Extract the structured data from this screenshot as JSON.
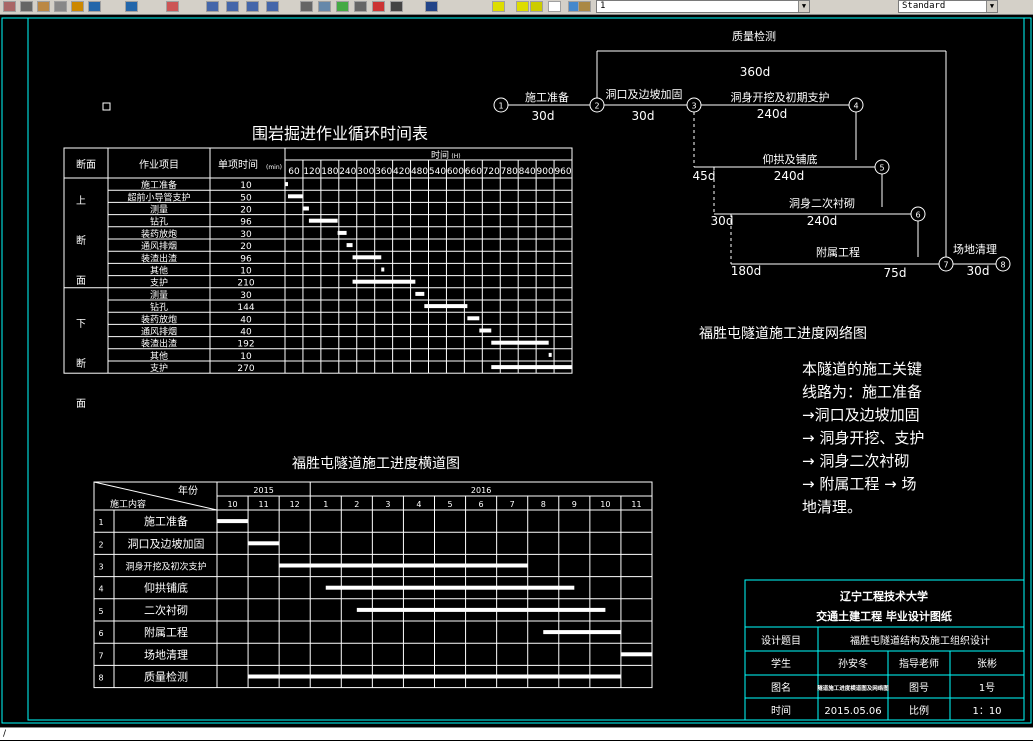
{
  "toolbar": {
    "layer_value": "1",
    "style_value": "Standard",
    "icons": [
      "cut-icon",
      "copy-icon",
      "paste-icon",
      "match-properties-icon",
      "brush-icon",
      "undo-icon",
      "redo-icon",
      "pan-icon",
      "zoom-realtime-icon",
      "zoom-window-icon",
      "zoom-previous-icon",
      "properties-icon",
      "design-center-icon",
      "tool-palettes-icon",
      "sheet-set-icon",
      "markup-icon",
      "calculator-icon",
      "help-icon",
      "layer-manager-icon",
      "lightbulb-icon",
      "sun-icon",
      "lock-icon",
      "color-square-icon",
      "layer-state-icon",
      "text-style-icon"
    ]
  },
  "cycle_table": {
    "title": "围岩掘进作业循环时间表",
    "headers": {
      "section": "断面",
      "task": "作业项目",
      "unit_time": "单项时间",
      "unit_time_unit": "(min)",
      "time": "时间",
      "time_unit": "(H)"
    },
    "ticks": [
      "60",
      "120",
      "180",
      "240",
      "300",
      "360",
      "420",
      "480",
      "540",
      "600",
      "660",
      "720",
      "780",
      "840",
      "900",
      "960"
    ],
    "upper_section": [
      "上",
      "断",
      "面"
    ],
    "lower_section": [
      "下",
      "断",
      "面"
    ],
    "rows": [
      {
        "task": "施工准备",
        "time": "10",
        "start": 0,
        "end": 10
      },
      {
        "task": "超前小导管支护",
        "time": "50",
        "start": 10,
        "end": 60
      },
      {
        "task": "测量",
        "time": "20",
        "start": 60,
        "end": 80
      },
      {
        "task": "钻孔",
        "time": "96",
        "start": 80,
        "end": 176
      },
      {
        "task": "装药放炮",
        "time": "30",
        "start": 176,
        "end": 206
      },
      {
        "task": "通风排烟",
        "time": "20",
        "start": 206,
        "end": 226
      },
      {
        "task": "装渣出渣",
        "time": "96",
        "start": 226,
        "end": 322
      },
      {
        "task": "其他",
        "time": "10",
        "start": 322,
        "end": 332
      },
      {
        "task": "支护",
        "time": "210",
        "start": 226,
        "end": 436
      },
      {
        "task": "测量",
        "time": "30",
        "start": 436,
        "end": 466
      },
      {
        "task": "钻孔",
        "time": "144",
        "start": 466,
        "end": 610
      },
      {
        "task": "装药放炮",
        "time": "40",
        "start": 610,
        "end": 650
      },
      {
        "task": "通风排烟",
        "time": "40",
        "start": 650,
        "end": 690
      },
      {
        "task": "装渣出渣",
        "time": "192",
        "start": 690,
        "end": 882
      },
      {
        "task": "其他",
        "time": "10",
        "start": 882,
        "end": 892
      },
      {
        "task": "支护",
        "time": "270",
        "start": 690,
        "end": 960
      }
    ]
  },
  "gantt": {
    "title": "福胜屯隧道施工进度横道图",
    "header_year": "年份",
    "header_content": "施工内容",
    "year_2015": "2015",
    "year_2016": "2016",
    "months": [
      "10",
      "11",
      "12",
      "1",
      "2",
      "3",
      "4",
      "5",
      "6",
      "7",
      "8",
      "9",
      "10",
      "11"
    ],
    "rows": [
      {
        "no": "1",
        "name": "施工准备",
        "start": 0,
        "end": 1
      },
      {
        "no": "2",
        "name": "洞口及边坡加固",
        "start": 1,
        "end": 2
      },
      {
        "no": "3",
        "name": "洞身开挖及初次支护",
        "start": 2,
        "end": 10
      },
      {
        "no": "4",
        "name": "仰拱铺底",
        "start": 3.5,
        "end": 11.5
      },
      {
        "no": "5",
        "name": "二次衬砌",
        "start": 4.5,
        "end": 12.5
      },
      {
        "no": "6",
        "name": "附属工程",
        "start": 10.5,
        "end": 13
      },
      {
        "no": "7",
        "name": "场地清理",
        "start": 13,
        "end": 14
      },
      {
        "no": "8",
        "name": "质量检测",
        "start": 1,
        "end": 13
      }
    ]
  },
  "network": {
    "caption": "福胜屯隧道施工进度网络图",
    "nodes": [
      "1",
      "2",
      "3",
      "4",
      "5",
      "6",
      "7",
      "8"
    ],
    "labels": {
      "quality_name": "质量检测",
      "quality_dur": "360d",
      "prep_name": "施工准备",
      "prep_dur": "30d",
      "portal_name": "洞口及边坡加固",
      "portal_dur": "30d",
      "excav_name": "洞身开挖及初期支护",
      "excav_dur": "240d",
      "invert_name": "仰拱及铺底",
      "invert_dur": "240d",
      "lining_name": "洞身二次衬砌",
      "lining_dur": "240d",
      "aux_name": "附属工程",
      "aux_dur": "75d",
      "clean_name": "场地清理",
      "clean_dur": "30d",
      "float_45": "45d",
      "float_30": "30d",
      "float_180": "180d"
    }
  },
  "critical_path": {
    "lines": [
      "本隧道的施工关键",
      "线路为：施工准备",
      "→洞口及边坡加固",
      "→ 洞身开挖、支护",
      "→ 洞身二次衬砌",
      "→ 附属工程 → 场",
      "地清理。"
    ]
  },
  "title_block": {
    "school": "辽宁工程技术大学",
    "subtitle": "交通土建工程 毕业设计图纸",
    "topic_label": "设计题目",
    "topic_value": "福胜屯隧道结构及施工组织设计",
    "student_label": "学生",
    "student_value": "孙安冬",
    "advisor_label": "指导老师",
    "advisor_value": "张彬",
    "figname_label": "图名",
    "figname_value": "隧道施工进度横道图及网络图",
    "fignum_label": "图号",
    "fignum_value": "1号",
    "time_label": "时间",
    "time_value": "2015.05.06",
    "scale_label": "比例",
    "scale_value": "1：10"
  },
  "command_line": "/",
  "colors": {
    "cyan": "#00ffff",
    "yellow": "#ffff00",
    "white": "#ffffff",
    "background": "#000000"
  }
}
